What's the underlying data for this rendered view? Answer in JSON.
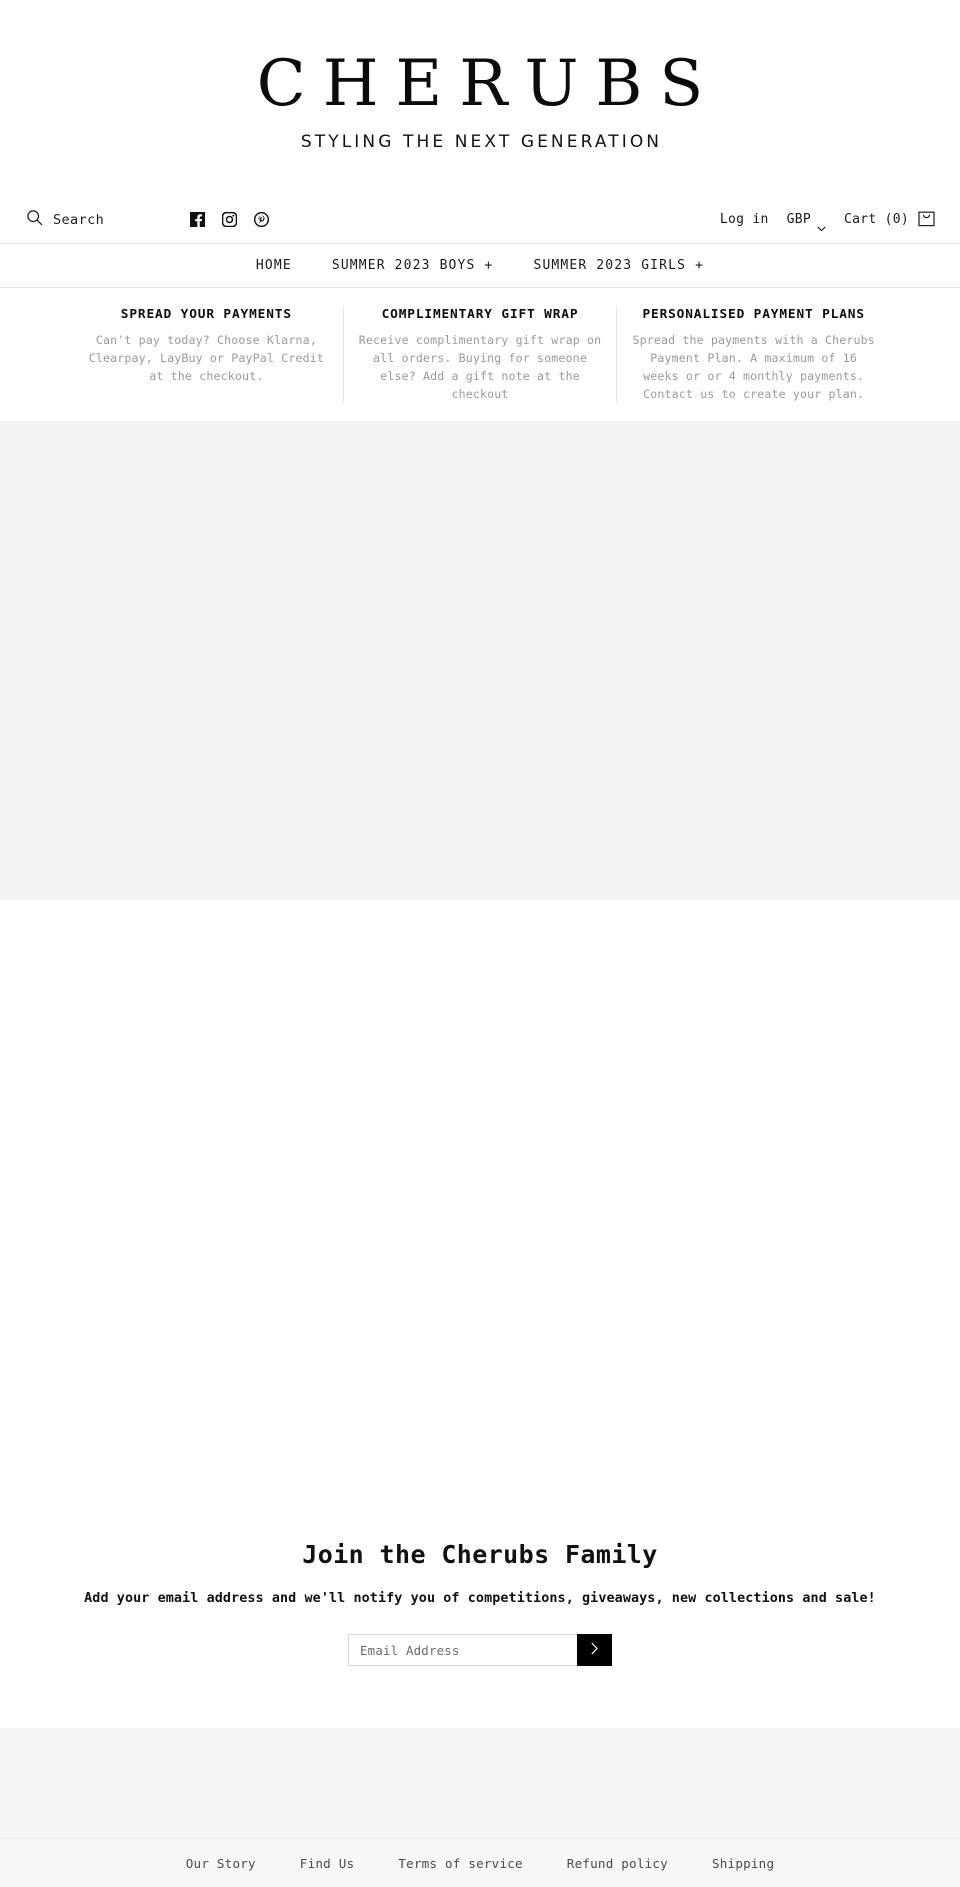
{
  "brand": {
    "logo": "CHERUBS",
    "tagline": "STYLING THE NEXT GENERATION"
  },
  "header": {
    "search_label": "Search",
    "socials": [
      {
        "name": "facebook-icon"
      },
      {
        "name": "instagram-icon"
      },
      {
        "name": "pinterest-icon"
      }
    ],
    "login_label": "Log in",
    "currency": "GBP",
    "cart_label": "Cart (0)",
    "cart_icon": "shopping-bag-icon"
  },
  "nav": {
    "items": [
      {
        "label": "HOME",
        "expandable": false,
        "plus": ""
      },
      {
        "label": "SUMMER 2023 BOYS",
        "expandable": true,
        "plus": "+"
      },
      {
        "label": "SUMMER 2023 GIRLS",
        "expandable": true,
        "plus": "+"
      }
    ]
  },
  "features": [
    {
      "title": "SPREAD YOUR PAYMENTS",
      "body": "Can't pay today? Choose Klarna, Clearpay, LayBuy or PayPal Credit at the checkout."
    },
    {
      "title": "COMPLIMENTARY GIFT WRAP",
      "body": "Receive complimentary gift wrap on all orders. Buying for someone else? Add a gift note at the checkout"
    },
    {
      "title": "PERSONALISED PAYMENT PLANS",
      "body": "Spread the payments with a Cherubs Payment Plan. A maximum of 16 weeks or or 4 monthly payments. Contact us to create your plan."
    }
  ],
  "newsletter": {
    "title": "Join the Cherubs Family",
    "subtitle": "Add your email address and we'll notify you of competitions, giveaways, new collections and sale!",
    "placeholder": "Email Address",
    "submit_icon": "chevron-right-icon"
  },
  "footer": {
    "links": [
      "Our Story",
      "Find Us",
      "Terms of service",
      "Refund policy",
      "Shipping"
    ]
  },
  "colors": {
    "accent": "#000000",
    "hero_placeholder": "#f3f3f3",
    "footer_grey": "#f4f5f6",
    "muted_text": "#9a9a9a",
    "border": "#e8e8e8"
  }
}
